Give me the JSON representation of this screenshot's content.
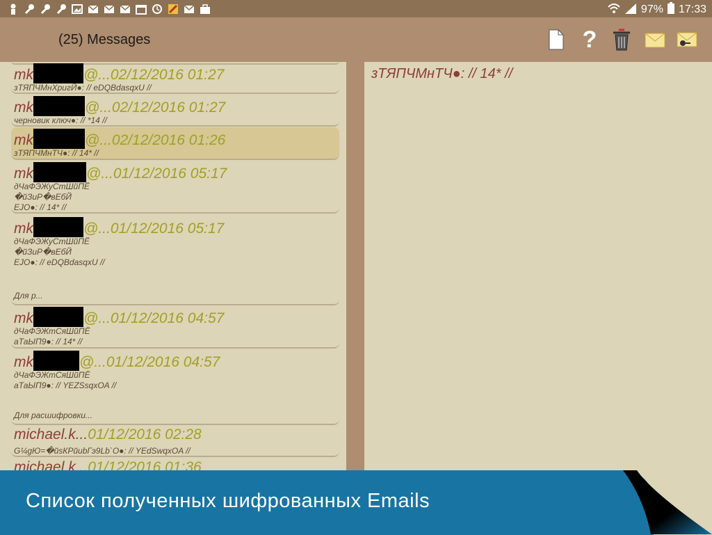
{
  "status_bar": {
    "battery": "97%",
    "time": "17:33"
  },
  "app_bar": {
    "title": "(25) Messages",
    "actions": [
      "new-document-icon",
      "help-icon",
      "delete-icon",
      "mail-icon",
      "mail-key-icon"
    ]
  },
  "messages": [
    {
      "sender_start": "mk",
      "sender_end": "@...",
      "date": "02/12/2016 01:27",
      "preview": [
        "зТЯПЧМнХригЙ●: // eDQBdasqxU  //"
      ],
      "selected": false
    },
    {
      "sender_start": "mk",
      "sender_end": "@...",
      "date": "02/12/2016 01:27",
      "preview": [
        "черновик ключ●: // *14 //"
      ],
      "selected": false
    },
    {
      "sender_start": "mk",
      "sender_end": "@...",
      "date": "02/12/2016 01:26",
      "preview": [
        "зТЯПЧМнТЧ●: // 14* //"
      ],
      "selected": true
    },
    {
      "sender_start": "mk",
      "sender_end": "@...",
      "date": "01/12/2016 05:17",
      "preview": [
        "дЧаФЭЖуСтШйПЁ",
        "�йЗиР�вЕбЙ",
        "EJO●: // 14* //"
      ],
      "selected": false
    },
    {
      "sender_start": "mk",
      "sender_end": "@...",
      "date": "01/12/2016 05:17",
      "preview": [
        "дЧаФЭЖуСтШйПЁ",
        "�йЗиР�вЕбЙ",
        "EJO●: // eDQBdasqxU  //"
      ],
      "selected": false
    },
    {
      "sender_start": "mk",
      "sender_end": "@...",
      "date": "01/12/2016 04:57",
      "preview": [
        "дЧаФЭЖтСяШйПЁ",
        "аТаЫП9●: // 14* //"
      ],
      "selected": false
    },
    {
      "sender_start": "mk",
      "sender_end": "@...",
      "date": "01/12/2016 04:57",
      "preview": [
        "дЧаФЭЖтСяШйПЁ",
        "аТаЫП9●: // YEZSsqxOA //"
      ],
      "selected": false
    },
    {
      "sender_start": "michael.k...",
      "sender_end": "",
      "date": "01/12/2016 02:28",
      "preview": [
        "G¼gЮ=�йsКРйиbГэ9Lb`O●: // YEdSwqxOA //"
      ],
      "selected": false
    },
    {
      "sender_start": "michael.k...",
      "sender_end": "",
      "date": "01/12/2016 01:36",
      "preview": [],
      "selected": false
    }
  ],
  "groups": [
    "Для р...",
    "Для расшифровки..."
  ],
  "detail": {
    "subject": "зТЯПЧМнТЧ●: // 14* //"
  },
  "banner": {
    "text": "Список полученных шифрованных Emails"
  }
}
